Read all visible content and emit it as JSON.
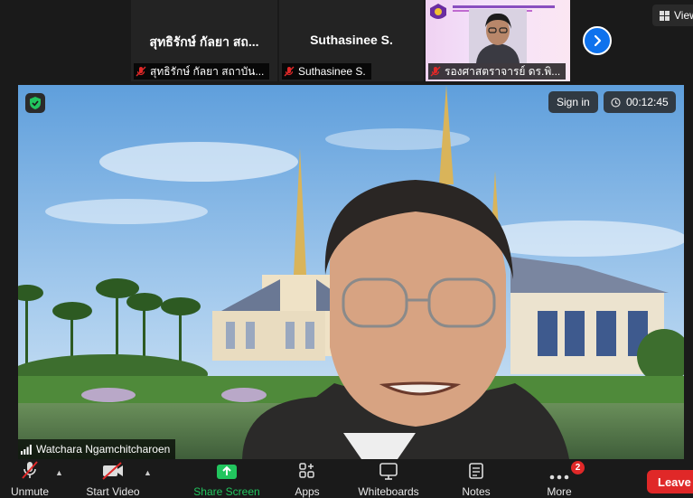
{
  "participants": [
    {
      "name": "สุทธิรักษ์ กัลยา สถ...",
      "caption": "สุทธิรักษ์ กัลยา สถาบัน...",
      "muted": true
    },
    {
      "name": "Suthasinee S.",
      "caption": "Suthasinee S.",
      "muted": true
    },
    {
      "name": "",
      "caption": "รองศาสตราจารย์ ดร.พิ...",
      "muted": true
    }
  ],
  "view_button": {
    "label": "View",
    "icon": "grid-icon"
  },
  "main": {
    "speaker_name": "Watchara Ngamchitcharoen",
    "sign_in_label": "Sign in",
    "timer": "00:12:45"
  },
  "toolbar": {
    "unmute": "Unmute",
    "start_video": "Start Video",
    "share_screen": "Share Screen",
    "apps": "Apps",
    "whiteboards": "Whiteboards",
    "notes": "Notes",
    "more": "More",
    "more_badge": "2",
    "leave": "Leave"
  },
  "colors": {
    "accent": "#0e72ed",
    "share": "#22c55e",
    "danger": "#e02828"
  }
}
